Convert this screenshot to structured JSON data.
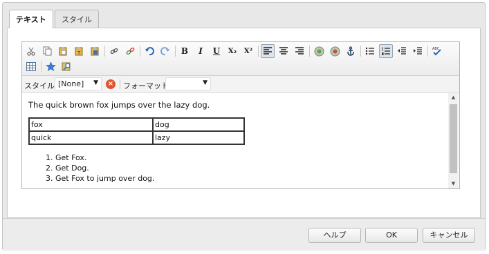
{
  "tabs": [
    {
      "label": "テキスト",
      "active": true
    },
    {
      "label": "スタイル",
      "active": false
    }
  ],
  "toolbar": {
    "row1": [
      "cut-icon",
      "copy-icon",
      "paste-icon",
      "paste-text-icon",
      "paste-word-icon",
      "link-icon",
      "unlink-icon",
      "undo-icon",
      "redo-icon",
      "bold-icon",
      "italic-icon",
      "underline-icon",
      "subscript-icon",
      "superscript-icon",
      "align-left-icon",
      "align-center-icon",
      "align-right-icon",
      "image-icon",
      "image-props-icon",
      "anchor-icon",
      "bullet-list-icon",
      "numbered-list-icon",
      "outdent-icon",
      "indent-icon",
      "spellcheck-icon"
    ],
    "row2": [
      "table-icon",
      "special-char-icon",
      "find-replace-icon"
    ],
    "bold": "B",
    "italic": "I",
    "underline": "U",
    "subscript": "X₂",
    "superscript": "X²"
  },
  "stylebar": {
    "style_label": "スタイル",
    "style_value": "[None]",
    "format_label": "フォーマット",
    "format_value": ""
  },
  "content": {
    "paragraph": "The quick brown fox jumps over the lazy dog.",
    "table": [
      [
        "fox",
        "dog"
      ],
      [
        "quick",
        "lazy"
      ]
    ],
    "list": [
      "Get Fox.",
      "Get Dog.",
      "Get Fox to jump over dog."
    ]
  },
  "buttons": {
    "help": "ヘルプ",
    "ok": "OK",
    "cancel": "キャンセル"
  },
  "colors": {
    "accent": "#dde4ec",
    "clear": "#e2532e",
    "anchor": "#2a6ebd"
  }
}
